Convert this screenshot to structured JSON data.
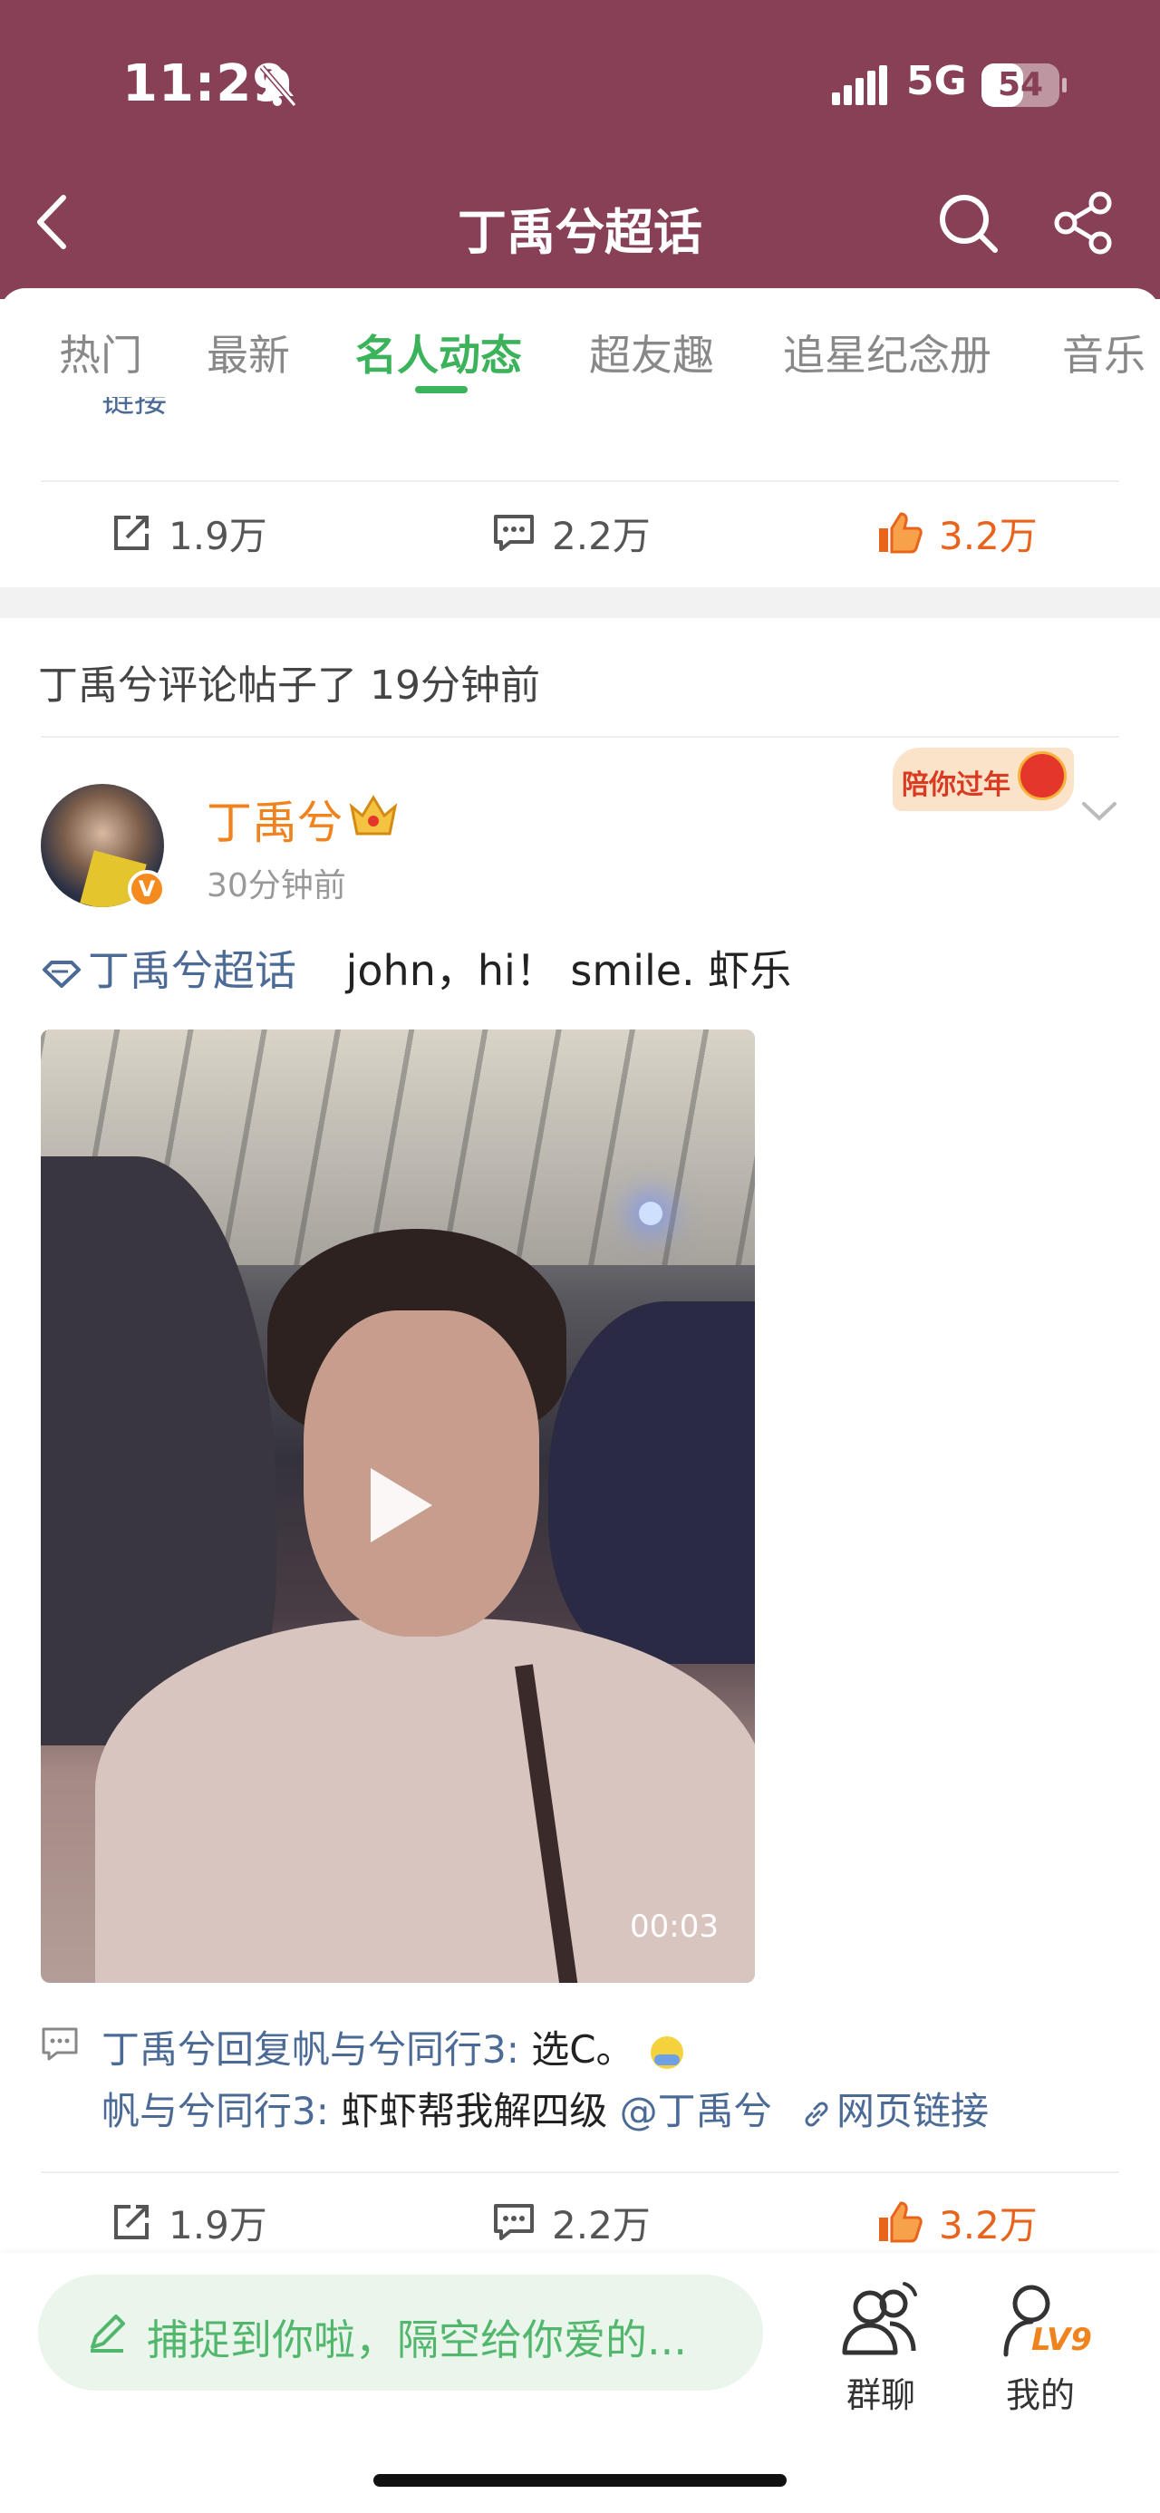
{
  "status": {
    "time": "11:29",
    "network": "5G",
    "battery": "54",
    "battery_level": 0.54
  },
  "nav": {
    "title": "丁禹兮超话"
  },
  "tabs": [
    "热门",
    "最新",
    "名人动态",
    "超友趣",
    "追星纪念册",
    "音乐"
  ],
  "active_tab": "名人动态",
  "prev_post": {
    "cut_text": "链接",
    "stats": {
      "repost": "1.9万",
      "comment": "2.2万",
      "like": "3.2万"
    }
  },
  "notice": "丁禹兮评论帖子了 19分钟前",
  "post": {
    "author": "丁禹兮",
    "time": "30分钟前",
    "sticker": "陪你过年",
    "topic": "丁禹兮超话",
    "text": "john，hi！ smile. 虾乐",
    "video_duration": "00:03",
    "comment_reply_user": "丁禹兮回复帆与兮同行3:",
    "comment_reply_text": "选C。",
    "comment_orig_user": "帆与兮同行3:",
    "comment_orig_text": "虾虾帮我解四级",
    "comment_mention": "@丁禹兮",
    "comment_link": "网页链接",
    "stats": {
      "repost": "1.9万",
      "comment": "2.2万",
      "like": "3.2万"
    }
  },
  "bottom": {
    "compose_placeholder": "捕捉到你啦，隔空给你爱的...",
    "group_chat": "群聊",
    "mine": "我的",
    "level": "LV9"
  },
  "colors": {
    "header": "#874056",
    "accent_green": "#3cb35a",
    "orange": "#f0831e",
    "link_blue": "#4c6a96"
  }
}
